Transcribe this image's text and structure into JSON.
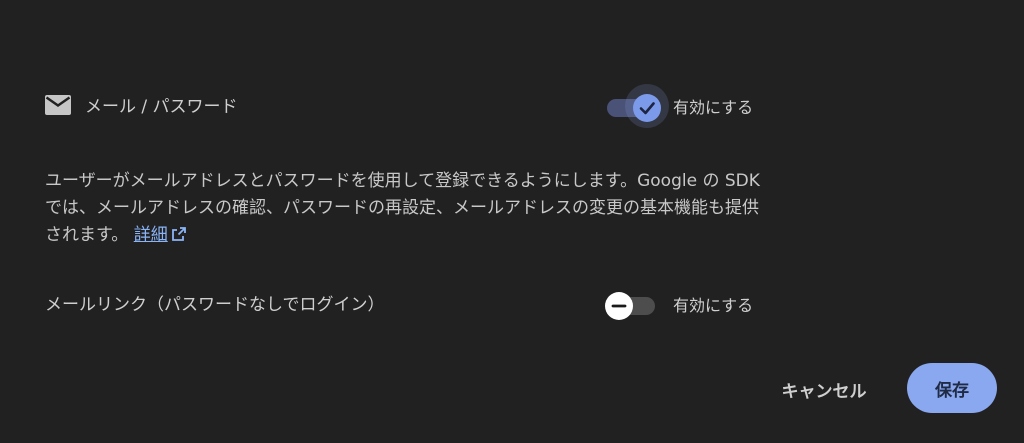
{
  "provider": {
    "icon": "mail-icon",
    "name": "メール / パスワード",
    "enabled": true,
    "toggle_label": "有効にする"
  },
  "description": {
    "text": "ユーザーがメールアドレスとパスワードを使用して登録できるようにします。Google の SDK では、メールアドレスの確認、パスワードの再設定、メールアドレスの変更の基本機能も提供されます。",
    "link_label": "詳細",
    "link_icon": "external-link-icon"
  },
  "email_link": {
    "name": "メールリンク（パスワードなしでログイン）",
    "enabled": false,
    "toggle_label": "有効にする"
  },
  "actions": {
    "cancel_label": "キャンセル",
    "save_label": "保存"
  },
  "colors": {
    "background": "#212121",
    "accent": "#8aa8ef",
    "link": "#8ab4f8"
  }
}
